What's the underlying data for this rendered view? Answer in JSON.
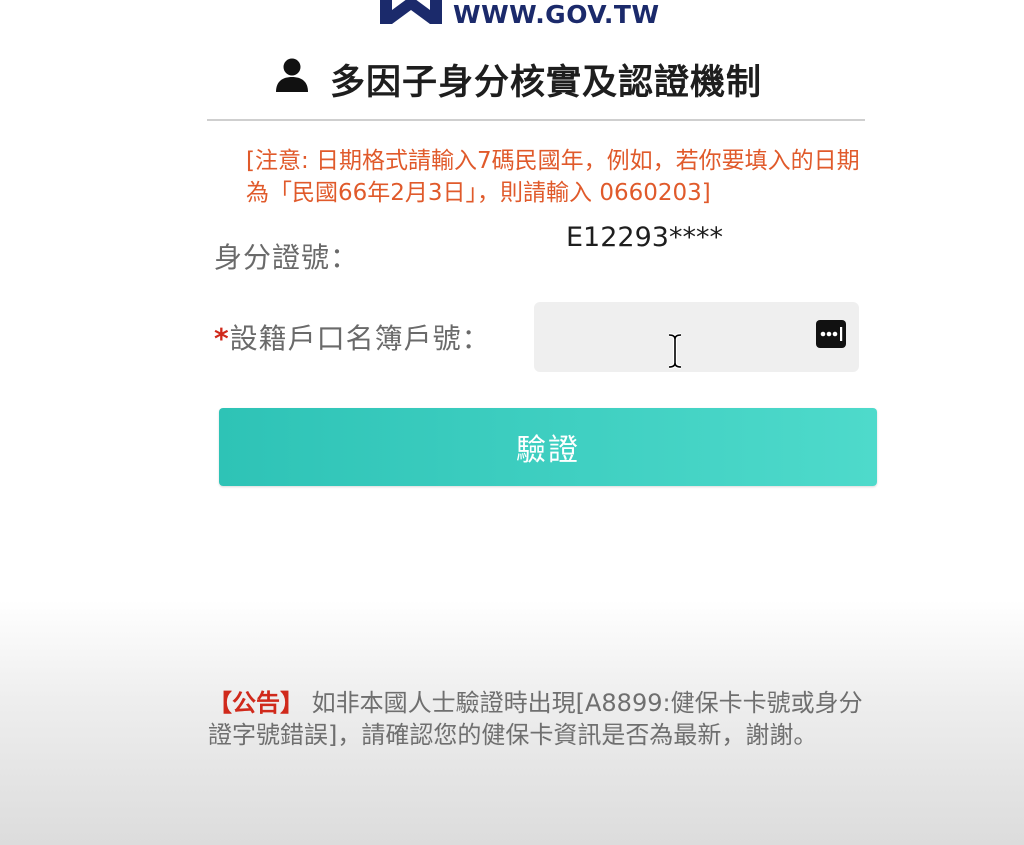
{
  "header": {
    "logo_text": "WWW.GOV.TW",
    "title": "多因子身分核實及認證機制"
  },
  "notice": {
    "text": "[注意: 日期格式請輸入7碼民國年，例如，若你要填入的日期為「民國66年2月3日」，則請輸入 0660203]"
  },
  "form": {
    "id_label": "身分證號：",
    "id_value": "E12293****",
    "household_required_mark": "*",
    "household_label": "設籍戶口名簿戶號：",
    "household_value": ""
  },
  "actions": {
    "verify_label": "驗證"
  },
  "announcement": {
    "tag": "【公告】",
    "text": " 如非本國人士驗證時出現[A8899:健保卡卡號或身分證字號錯誤]，請確認您的健保卡資訊是否為最新，謝謝。"
  },
  "colors": {
    "notice": "#e05a2b",
    "button_start": "#2ec3b6",
    "button_end": "#4edacb",
    "required": "#d0291b",
    "logo": "#1b2a6b"
  },
  "icons": {
    "user": "user-icon",
    "password_manager": "key-icon",
    "cursor": "text-cursor-icon"
  }
}
